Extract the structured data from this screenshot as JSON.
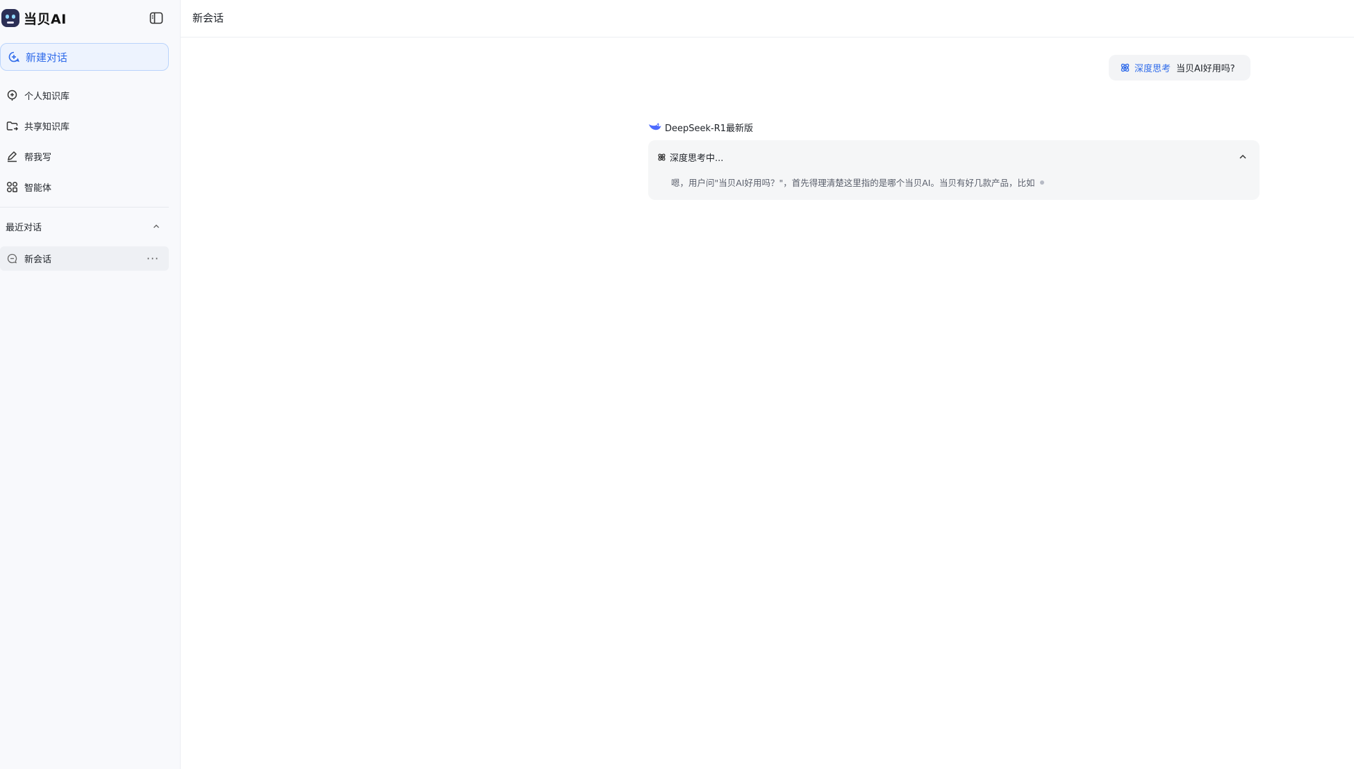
{
  "brand": {
    "name": "当贝AI"
  },
  "sidebar": {
    "new_chat_label": "新建对话",
    "items": [
      {
        "label": "个人知识库",
        "icon": "knowledge-base-icon"
      },
      {
        "label": "共享知识库",
        "icon": "shared-folder-icon"
      },
      {
        "label": "帮我写",
        "icon": "write-pen-icon"
      },
      {
        "label": "智能体",
        "icon": "apps-grid-icon"
      }
    ],
    "recent": {
      "title": "最近对话",
      "items": [
        {
          "label": "新会话",
          "more": "···"
        }
      ]
    }
  },
  "header": {
    "title": "新会话"
  },
  "chat": {
    "user_message": {
      "mode_tag": "深度思考",
      "text": "当贝AI好用吗?"
    },
    "assistant": {
      "model_name": "DeepSeek-R1最新版",
      "thinking_label": "深度思考中...",
      "thinking_text": "嗯，用户问\"当贝AI好用吗？\"，首先得理清楚这里指的是哪个当贝AI。当贝有好几款产品，比如"
    }
  },
  "colors": {
    "accent": "#2f6bea",
    "sidebar_bg": "#f8f9fc",
    "bubble_bg": "#f3f4f6"
  }
}
